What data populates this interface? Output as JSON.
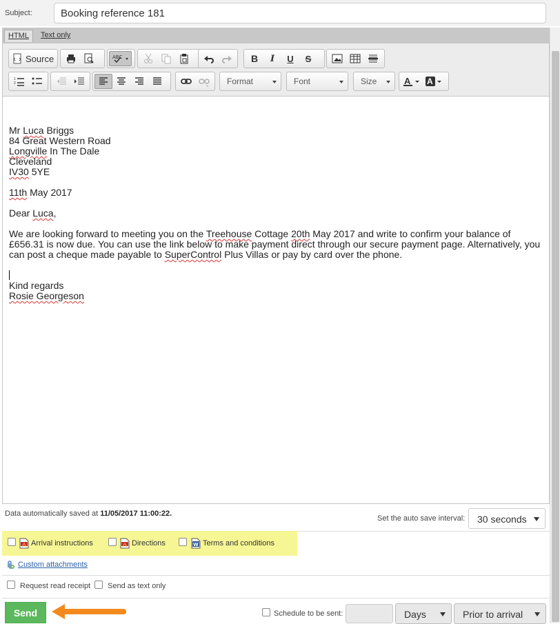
{
  "subject": {
    "label": "Subject:",
    "value": "Booking reference 181"
  },
  "mode_tabs": {
    "html": "HTML",
    "text": "Text only"
  },
  "toolbar": {
    "source_label": "Source",
    "format": "Format",
    "font": "Font",
    "size": "Size",
    "bold": "B",
    "italic": "I",
    "underline": "U",
    "strike": "S",
    "spell_label": "ABC"
  },
  "letter": {
    "line1_pre": "Mr ",
    "line1_sp": "Luca",
    "line1_post": " Briggs",
    "line2": "84 Great Western Road",
    "line3_sp": "Longville",
    "line3_post": " In The Dale",
    "line4": "Cleveland",
    "line5_sp": "IV30",
    "line5_post": " 5YE",
    "date_sp": "11th",
    "date_post": " May 2017",
    "greet_pre": "Dear ",
    "greet_sp": "Luca",
    "greet_post": ",",
    "body_1": "We are looking forward to meeting you on the ",
    "body_sp1": "Treehouse",
    "body_2": " Cottage ",
    "body_sp2": "20th",
    "body_3": " May 2017 and write to confirm your balance of £656.31 is now due. You can use the link below to make payment direct through our secure payment page. Alternatively, you can post a cheque made payable to ",
    "body_sp3": "SuperControl",
    "body_4": " Plus Villas or pay by card over the phone.",
    "closing": "Kind regards",
    "sig_sp": "Rosie Georgeson"
  },
  "autosave": {
    "text": "Data automatically saved at ",
    "stamp": "11/05/2017 11:00:22.",
    "interval_label": "Set the auto save interval:",
    "interval_value": "30 seconds"
  },
  "attachments": [
    {
      "label": "Arrival instructions",
      "type": "pdf"
    },
    {
      "label": "Directions",
      "type": "pdf"
    },
    {
      "label": "Terms and conditions",
      "type": "word"
    }
  ],
  "custom_attachments": "Custom attachments",
  "options": {
    "read_receipt": "Request read receipt",
    "send_text": "Send as text only"
  },
  "send_label": "Send",
  "schedule": {
    "label": "Schedule to be sent:",
    "units": "Days",
    "relation": "Prior to arrival"
  },
  "colors": {
    "highlight": "#f6f695",
    "send": "#5cb85c",
    "arrow": "#f28a1e"
  }
}
